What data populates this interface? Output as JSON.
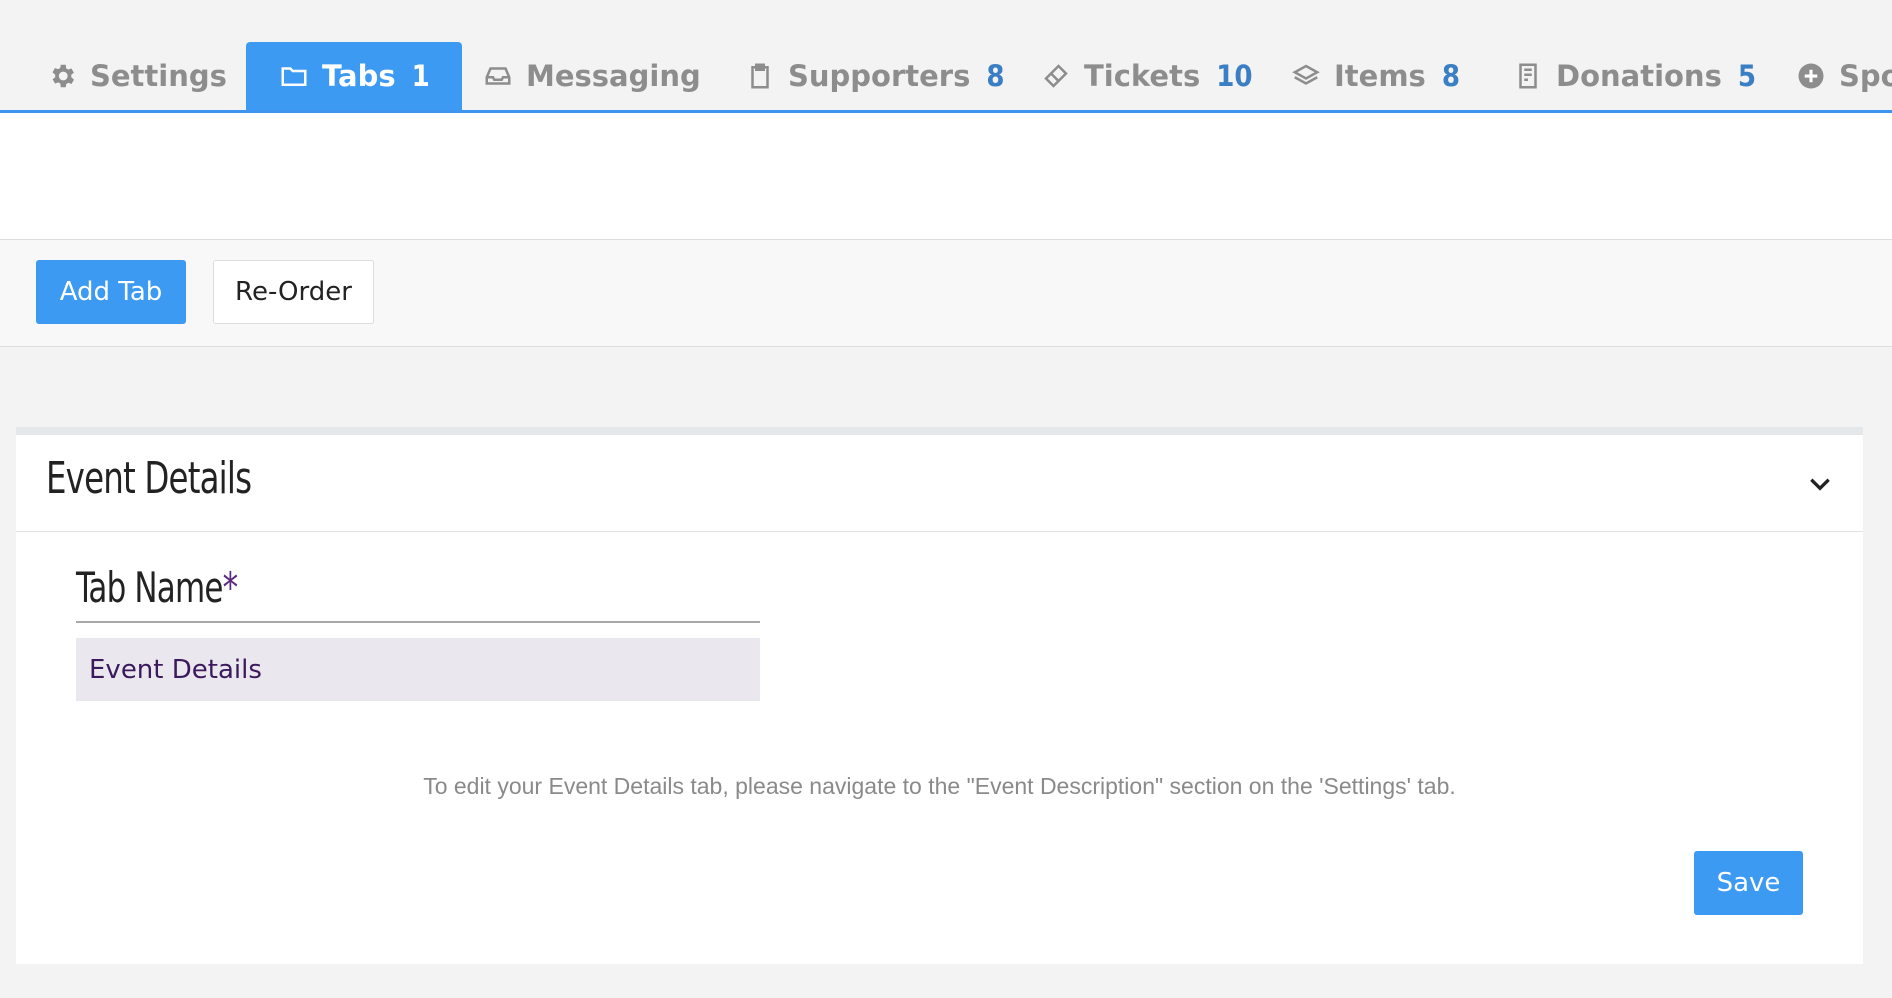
{
  "tabs": [
    {
      "label": "Settings",
      "count": "",
      "icon": "gear-icon"
    },
    {
      "label": "Tabs",
      "count": "1",
      "icon": "folder-icon",
      "active": true
    },
    {
      "label": "Messaging",
      "count": "",
      "icon": "inbox-icon"
    },
    {
      "label": "Supporters",
      "count": "8",
      "icon": "clipboard-icon"
    },
    {
      "label": "Tickets",
      "count": "10",
      "icon": "ticket-icon"
    },
    {
      "label": "Items",
      "count": "8",
      "icon": "layers-icon"
    },
    {
      "label": "Donations",
      "count": "5",
      "icon": "receipt-icon"
    },
    {
      "label": "Spo",
      "count": "",
      "icon": "plus-circle-icon"
    }
  ],
  "toolbar": {
    "add_tab_label": "Add Tab",
    "reorder_label": "Re-Order"
  },
  "panel": {
    "title": "Event Details",
    "field_label": "Tab Name",
    "required_mark": "*",
    "field_value": "Event Details",
    "help_text": "To edit your Event Details tab, please navigate to the \"Event Description\" section on the 'Settings' tab.",
    "save_label": "Save"
  },
  "colors": {
    "accent": "#3d9af2",
    "count": "#3a7ec4",
    "required": "#5b2a7f"
  }
}
